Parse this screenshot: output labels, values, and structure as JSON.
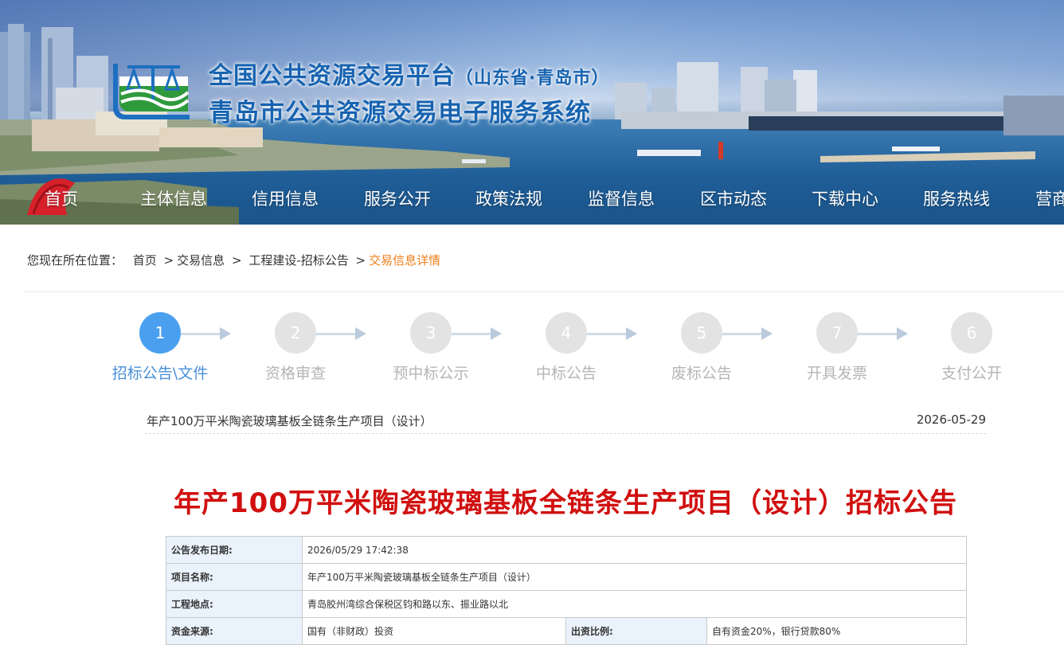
{
  "header": {
    "title_main": "全国公共资源交易平台",
    "title_sub": "（山东省·青岛市）",
    "system_name": "青岛市公共资源交易电子服务系统"
  },
  "nav": {
    "items": [
      {
        "label": "首页"
      },
      {
        "label": "主体信息"
      },
      {
        "label": "信用信息"
      },
      {
        "label": "服务公开"
      },
      {
        "label": "政策法规"
      },
      {
        "label": "监督信息"
      },
      {
        "label": "区市动态"
      },
      {
        "label": "下载中心"
      },
      {
        "label": "服务热线"
      },
      {
        "label": "营商"
      }
    ]
  },
  "breadcrumb": {
    "prefix": "您现在所在位置：",
    "items": [
      "首页",
      "交易信息",
      "工程建设-招标公告"
    ],
    "current": "交易信息详情"
  },
  "steps": [
    {
      "number": "1",
      "label": "招标公告\\文件",
      "active": true
    },
    {
      "number": "2",
      "label": "资格审查",
      "active": false
    },
    {
      "number": "3",
      "label": "预中标公示",
      "active": false
    },
    {
      "number": "4",
      "label": "中标公告",
      "active": false
    },
    {
      "number": "5",
      "label": "废标公告",
      "active": false
    },
    {
      "number": "7",
      "label": "开具发票",
      "active": false
    },
    {
      "number": "6",
      "label": "支付公开",
      "active": false
    }
  ],
  "project_row": {
    "name": "年产100万平米陶瓷玻璃基板全链条生产项目（设计）",
    "date": "2026-05-29"
  },
  "main_title": "年产100万平米陶瓷玻璃基板全链条生产项目（设计）招标公告",
  "info": {
    "publish_date_label": "公告发布日期:",
    "publish_date_value": "2026/05/29 17:42:38",
    "project_name_label": "项目名称:",
    "project_name_value": "年产100万平米陶瓷玻璃基板全链条生产项目（设计）",
    "location_label": "工程地点:",
    "location_value": "青岛胶州湾综合保税区钧和路以东、振业路以北",
    "funding_label": "资金来源:",
    "funding_value": "国有（非财政）投资",
    "ratio_label": "出资比例:",
    "ratio_value": "自有资金20%，银行贷款80%"
  },
  "colors": {
    "accent_blue": "#4aa0ef",
    "title_red": "#d10f0f",
    "breadcrumb_current": "#f07d1a",
    "header_blue": "#1763b0"
  }
}
